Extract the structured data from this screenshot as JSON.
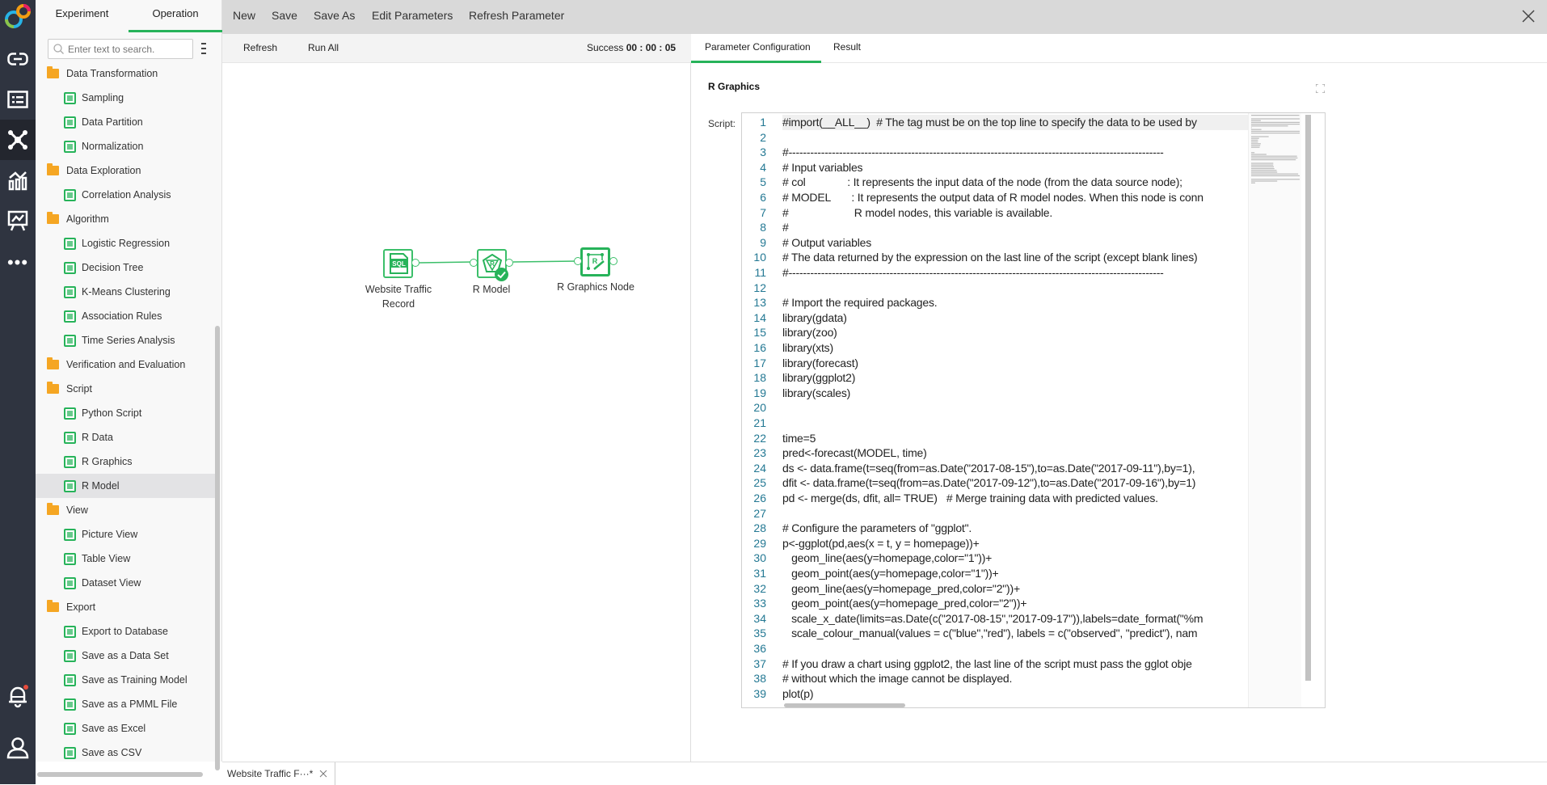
{
  "rail": {
    "icons": [
      "logo-icon",
      "link-icon",
      "list-icon",
      "network-icon",
      "chart-icon",
      "presentation-icon",
      "more-icon",
      "bell-icon",
      "user-icon"
    ],
    "accent": "#27b35a"
  },
  "sidebar": {
    "tabs": [
      {
        "label": "Experiment"
      },
      {
        "label": "Operation",
        "active": true
      }
    ],
    "search_placeholder": "Enter text to search.",
    "tree": [
      {
        "type": "cat",
        "label": "Data Transformation"
      },
      {
        "type": "item",
        "label": "Sampling"
      },
      {
        "type": "item",
        "label": "Data Partition"
      },
      {
        "type": "item",
        "label": "Normalization"
      },
      {
        "type": "cat",
        "label": "Data Exploration"
      },
      {
        "type": "item",
        "label": "Correlation Analysis"
      },
      {
        "type": "cat",
        "label": "Algorithm"
      },
      {
        "type": "item",
        "label": "Logistic Regression"
      },
      {
        "type": "item",
        "label": "Decision Tree"
      },
      {
        "type": "item",
        "label": "K-Means Clustering"
      },
      {
        "type": "item",
        "label": "Association Rules"
      },
      {
        "type": "item",
        "label": "Time Series Analysis"
      },
      {
        "type": "cat",
        "label": "Verification and Evaluation"
      },
      {
        "type": "cat",
        "label": "Script"
      },
      {
        "type": "item",
        "label": "Python Script"
      },
      {
        "type": "item",
        "label": "R Data"
      },
      {
        "type": "item",
        "label": "R Graphics"
      },
      {
        "type": "item",
        "label": "R Model",
        "selected": true
      },
      {
        "type": "cat",
        "label": "View"
      },
      {
        "type": "item",
        "label": "Picture View"
      },
      {
        "type": "item",
        "label": "Table View"
      },
      {
        "type": "item",
        "label": "Dataset View"
      },
      {
        "type": "cat",
        "label": "Export"
      },
      {
        "type": "item",
        "label": "Export to Database"
      },
      {
        "type": "item",
        "label": "Save as a Data Set"
      },
      {
        "type": "item",
        "label": "Save as Training Model"
      },
      {
        "type": "item",
        "label": "Save as a PMML File"
      },
      {
        "type": "item",
        "label": "Save as Excel"
      },
      {
        "type": "item",
        "label": "Save as CSV"
      }
    ]
  },
  "toolbar": {
    "items": [
      "New",
      "Save",
      "Save As",
      "Edit Parameters",
      "Refresh Parameter"
    ]
  },
  "canvas": {
    "refresh": "Refresh",
    "run_all": "Run All",
    "status_label": "Success",
    "status_time": "00 : 00 : 05",
    "nodes": [
      {
        "label": "Website Traffic Record",
        "icon": "sql-icon"
      },
      {
        "label": "R Model",
        "icon": "r-model-icon",
        "status": "success"
      },
      {
        "label": "R Graphics Node",
        "icon": "r-graphics-icon"
      }
    ]
  },
  "panel": {
    "tabs": [
      {
        "label": "Parameter Configuration",
        "active": true
      },
      {
        "label": "Result"
      }
    ],
    "title": "R Graphics",
    "script_label": "Script:",
    "code": [
      "#import(__ALL__)  # The tag must be on the top line to specify the data to be used by",
      "",
      "#--------------------------------------------------------------------------------------------------------",
      "# Input variables",
      "# col              : It represents the input data of the node (from the data source node);",
      "# MODEL       : It represents the output data of R model nodes. When this node is conn",
      "#                      R model nodes, this variable is available.",
      "#",
      "# Output variables",
      "# The data returned by the expression on the last line of the script (except blank lines)",
      "#--------------------------------------------------------------------------------------------------------",
      "",
      "# Import the required packages.",
      "library(gdata)",
      "library(zoo)",
      "library(xts)",
      "library(forecast)",
      "library(ggplot2)",
      "library(scales)",
      "",
      "",
      "time=5",
      "pred<-forecast(MODEL, time)",
      "ds <- data.frame(t=seq(from=as.Date(\"2017-08-15\"),to=as.Date(\"2017-09-11\"),by=1),",
      "dfit <- data.frame(t=seq(from=as.Date(\"2017-09-12\"),to=as.Date(\"2017-09-16\"),by=1)",
      "pd <- merge(ds, dfit, all= TRUE)   # Merge training data with predicted values.",
      "",
      "# Configure the parameters of \"ggplot\".",
      "p<-ggplot(pd,aes(x = t, y = homepage))+",
      "   geom_line(aes(y=homepage,color=\"1\"))+",
      "   geom_point(aes(y=homepage,color=\"1\"))+",
      "   geom_line(aes(y=homepage_pred,color=\"2\"))+",
      "   geom_point(aes(y=homepage_pred,color=\"2\"))+",
      "   scale_x_date(limits=as.Date(c(\"2017-08-15\",\"2017-09-17\")),labels=date_format(\"%m",
      "   scale_colour_manual(values = c(\"blue\",\"red\"), labels = c(\"observed\", \"predict\"), nam",
      "",
      "# If you draw a chart using ggplot2, the last line of the script must pass the gglot obje",
      "# without which the image cannot be displayed.",
      "plot(p)"
    ]
  },
  "bottom_tab": {
    "label": "Website Traffic F···*"
  }
}
